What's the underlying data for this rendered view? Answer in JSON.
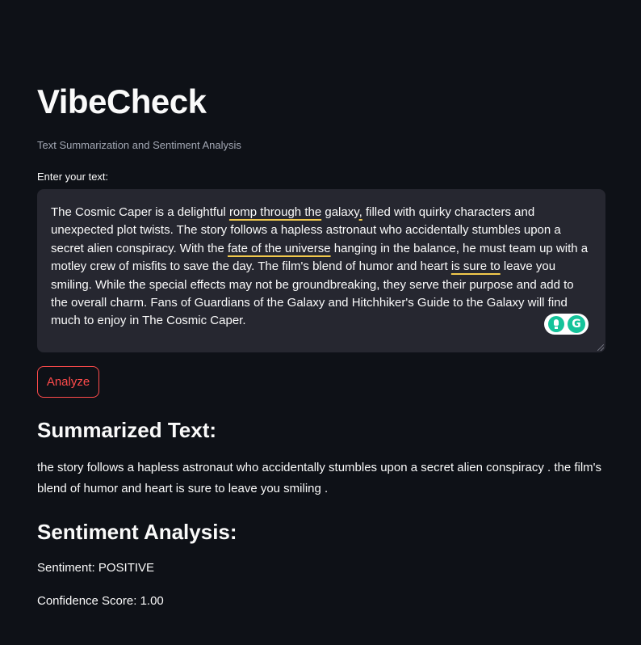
{
  "app": {
    "title": "VibeCheck",
    "subtitle": "Text Summarization and Sentiment Analysis"
  },
  "input": {
    "label": "Enter your text:",
    "segments": [
      {
        "text": "The Cosmic Caper is a delightful ",
        "flag": false
      },
      {
        "text": "romp through the",
        "flag": true
      },
      {
        "text": " galaxy",
        "flag": false
      },
      {
        "text": ",",
        "flag": true
      },
      {
        "text": " filled with quirky characters and unexpected plot twists. The story follows a hapless astronaut who accidentally stumbles upon a secret alien conspiracy. With the ",
        "flag": false
      },
      {
        "text": "fate of the universe",
        "flag": true
      },
      {
        "text": " hanging in the balance, he must team up with a motley crew of misfits to save the day. The film's blend of humor and heart ",
        "flag": false
      },
      {
        "text": "is sure to",
        "flag": true
      },
      {
        "text": " leave you smiling. While the special effects may not be groundbreaking, they serve their purpose and add to the overall charm. Fans of Guardians of the Galaxy and Hitchhiker's Guide to the Galaxy will find much to enjoy in The Cosmic Caper.",
        "flag": false
      }
    ],
    "grammarly_badge": {
      "icons": [
        "lightbulb-icon",
        "grammarly-logo-icon"
      ],
      "logo_letter": "G",
      "color": "#15c39a"
    },
    "underline_color": "#f2c94c"
  },
  "actions": {
    "analyze_label": "Analyze"
  },
  "summary": {
    "heading": "Summarized Text:",
    "text": "the story follows a hapless astronaut who accidentally stumbles upon a secret alien conspiracy . the film's blend of humor and heart is sure to leave you smiling ."
  },
  "sentiment": {
    "heading": "Sentiment Analysis:",
    "sentiment_line": "Sentiment: POSITIVE",
    "confidence_line": "Confidence Score: 1.00"
  },
  "colors": {
    "background": "#0e1117",
    "input_background": "#262730",
    "accent": "#ff4b4b",
    "text": "#fafafa",
    "muted_text": "#a3a8b4"
  }
}
